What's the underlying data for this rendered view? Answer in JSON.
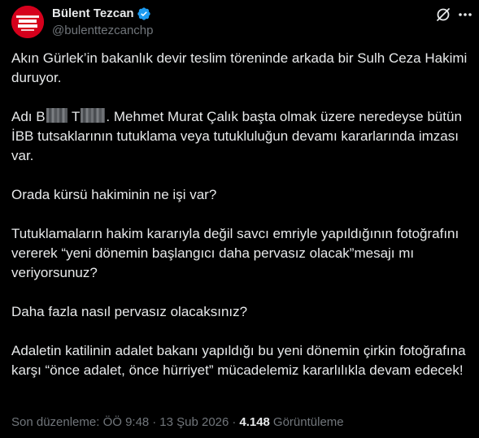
{
  "author": {
    "display_name": "Bülent Tezcan",
    "handle": "@bulenttezcanchp",
    "avatar_text": "ADALET HÜRRİYET"
  },
  "post": {
    "paragraphs": [
      [
        "Akın Gürlek’in bakanlık devir teslim töreninde arkada bir Sulh Ceza Hakimi duruyor."
      ],
      [
        "Adı B",
        "",
        " T",
        "",
        ". Mehmet Murat Çalık başta olmak üzere neredeyse bütün İBB tutsaklarının tutuklama veya tutukluluğun devamı kararlarında imzası var."
      ],
      [
        "Orada kürsü hakiminin ne işi var?"
      ],
      [
        "Tutuklamaların hakim kararıyla değil savcı emriyle yapıldığının fotoğrafını vererek “yeni dönemin başlangıcı daha pervasız olacak”mesajı mı veriyorsunuz?"
      ],
      [
        "Daha fazla nasıl pervasız olacaksınız?"
      ],
      [
        "Adaletin katilinin adalet bakanı yapıldığı bu yeni dönemin çirkin fotoğrafına karşı “önce adalet, önce hürriyet” mücadelemiz kararlılıkla devam edecek!"
      ]
    ]
  },
  "meta": {
    "edited_prefix": "Son düzenleme: ÖÖ 9:48",
    "dot": "·",
    "date": "13 Şub 2026",
    "views_count": "4.148",
    "views_label": "Görüntüleme"
  },
  "icons": {
    "verified": "verified-badge-icon",
    "grok": "grok-icon",
    "more": "more-icon"
  },
  "colors": {
    "background": "#000000",
    "text": "#e7e9ea",
    "secondary": "#71767b",
    "verified": "#1d9bf0",
    "avatar_red": "#d6001c"
  }
}
